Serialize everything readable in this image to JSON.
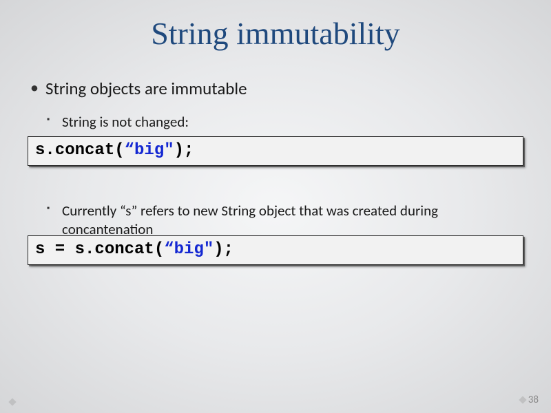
{
  "title": "String immutability",
  "bullets": {
    "main": "String objects are immutable",
    "sub1": "String is not changed:",
    "sub2": "Currently “s” refers to new String object that was created during concantenation"
  },
  "code1": {
    "left": "s.concat(",
    "str": "“big\"",
    "right": ");"
  },
  "code2": {
    "left": "s = s.concat(",
    "str": "“big\"",
    "right": ");"
  },
  "page_number": "38"
}
